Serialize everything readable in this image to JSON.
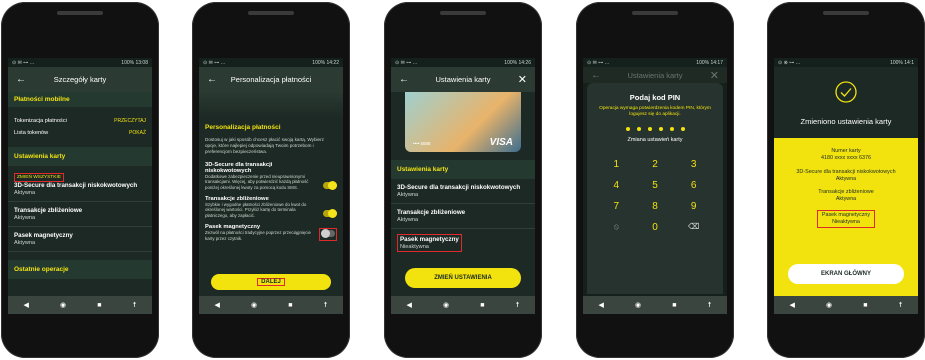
{
  "status": {
    "s1_time": "13:08",
    "s2_time": "14:22",
    "s3_time": "14:26",
    "s4_time": "14:17",
    "s5_time": "14:1",
    "battery": "100%"
  },
  "screen1": {
    "title": "Szczegóły karty",
    "section_payments": "Płatności mobilne",
    "tokenization_label": "Tokenizacja płatności",
    "tokenization_action": "PRZECZYTAJ",
    "tokens_label": "Lista tokenów",
    "tokens_action": "POKAŻ",
    "section_settings": "Ustawienia karty",
    "change_all": "ZMIEŃ WSZYSTKIE",
    "item1_title": "3D-Secure dla transakcji niskokwotowych",
    "item1_status": "Aktywna",
    "item2_title": "Transakcje zbliżeniowe",
    "item2_status": "Aktywna",
    "item3_title": "Pasek magnetyczny",
    "item3_status": "Aktywna",
    "section_ops": "Ostatnie operacje"
  },
  "screen2": {
    "title": "Personalizacja płatności",
    "heading": "Personalizacja płatności",
    "intro": "Dostosuj w jaki sposób chcesz płacić swoją kartą. Wybierz opcje, które najlepiej odpowiadają Twoim potrzebom i preferencjom bezpieczeństwa.",
    "opt1_title": "3D-Secure dla transakcji niskokwotowych",
    "opt1_desc": "Dodatkowe zabezpieczenie przed nieuprawnionymi transakcjami. Więcej, aby potwierdzić każdą płatność poniżej określonej kwoty za pomocą kodu SMS.",
    "opt2_title": "Transakcje zbliżeniowe",
    "opt2_desc": "Szybkie i wygodne płatności zbliżeniowe do kwot do określonej wartości. Przyłóż kartę do terminala płatniczego, aby zapłacić.",
    "opt3_title": "Pasek magnetyczny",
    "opt3_desc": "Zezwól na płatności tradycyjne poprzez przeciągnięcie karty przez czytnik.",
    "next_button": "DALEJ"
  },
  "screen3": {
    "title": "Ustawienia karty",
    "card_brand": "VISA",
    "card_mask": "•••• 5888",
    "section": "Ustawienia karty",
    "item1_title": "3D-Secure dla transakcji niskokwotowych",
    "item1_status": "Aktywna",
    "item2_title": "Transakcje zbliżeniowe",
    "item2_status": "Aktywna",
    "item3_title": "Pasek magnetyczny",
    "item3_status": "Nieaktywna",
    "button": "ZMIEŃ USTAWIENIA"
  },
  "screen4": {
    "title": "Ustawienia karty",
    "heading": "Podaj kod PIN",
    "desc": "Operacja wymaga potwierdzenia kodem PIN, którym logujesz się do aplikacji.",
    "subtitle": "Zmiana ustawień karty",
    "keys": [
      "1",
      "2",
      "3",
      "4",
      "5",
      "6",
      "7",
      "8",
      "9",
      "",
      "0",
      ""
    ]
  },
  "screen5": {
    "title": "Zmieniono ustawienia karty",
    "card_label": "Numer karty",
    "card_number": "4180 xxxx xxxx 6376",
    "item1_title": "3D-Secure dla transakcji niskokwotowych",
    "item1_status": "Aktywna",
    "item2_title": "Transakcje zbliżeniowe",
    "item2_status": "Aktywna",
    "item3_title": "Pasek magnetyczny",
    "item3_status": "Nieaktywna",
    "button": "EKRAN GŁÓWNY"
  },
  "colors": {
    "accent": "#f2e30f",
    "bg": "#1d2924",
    "highlight": "#e02a2a"
  }
}
